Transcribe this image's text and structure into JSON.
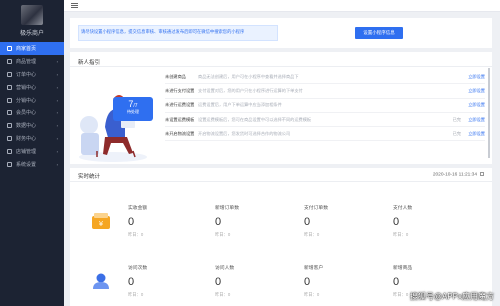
{
  "brand": {
    "name": "极乐商户"
  },
  "sidebar": {
    "items": [
      {
        "label": "商家首页"
      },
      {
        "label": "商品管理"
      },
      {
        "label": "订单中心"
      },
      {
        "label": "营销中心"
      },
      {
        "label": "分销中心"
      },
      {
        "label": "会员中心"
      },
      {
        "label": "数据中心"
      },
      {
        "label": "财务中心"
      },
      {
        "label": "店铺管理"
      },
      {
        "label": "系统设置"
      }
    ]
  },
  "notice": {
    "text": "请尽快设置小程序信息，提交信息审核、审核通过发布后即可在微信中搜索您的小程序",
    "button": "设置小程序信息"
  },
  "guide": {
    "title": "新人指引",
    "badge_num": "7",
    "badge_unit": "/7",
    "badge_label": "待处理",
    "tasks": [
      {
        "title": "未创建商品",
        "desc": "商品无法创建后，用户可在小程序中查看并选择商品下",
        "status": "",
        "action": "立即设置"
      },
      {
        "title": "未进行支付设置",
        "desc": "支付设置对后，您的用户只在小程序进行运算的下单支付",
        "status": "",
        "action": "立即设置"
      },
      {
        "title": "未进行运费设置",
        "desc": "运费设置后，用户下单运算中应当添加相条件",
        "status": "",
        "action": "立即设置"
      },
      {
        "title": "未设置运费模板",
        "desc": "设置运费模板后，您可在商品设置中可以选择不同的运费模板",
        "status": "已完",
        "action": "立即设置"
      },
      {
        "title": "未开启物流设置",
        "desc": "开启物流设置后，您发货时可选择合作的物流公司",
        "status": "已完",
        "action": "立即设置"
      }
    ]
  },
  "stats": {
    "title": "实时统计",
    "time": "2020-10-16 11:21:34",
    "rows": [
      [
        {
          "label": "实收金额",
          "value": "0",
          "sub": "昨日：0"
        },
        {
          "label": "新增订单数",
          "value": "0",
          "sub": "昨日：0"
        },
        {
          "label": "支付订单数",
          "value": "0",
          "sub": "昨日：0"
        },
        {
          "label": "支付人数",
          "value": "0",
          "sub": "昨日：0"
        }
      ],
      [
        {
          "label": "访问次数",
          "value": "0",
          "sub": "昨日：0"
        },
        {
          "label": "访问人数",
          "value": "0",
          "sub": "昨日：0"
        },
        {
          "label": "新增客户",
          "value": "0",
          "sub": "昨日：0"
        },
        {
          "label": "新增商品",
          "value": "0",
          "sub": "昨日：0"
        }
      ]
    ]
  },
  "watermark": "搜狐号@APPx应用魔方",
  "colors": {
    "accent": "#2f6ff0",
    "sidebar": "#1c2333"
  }
}
